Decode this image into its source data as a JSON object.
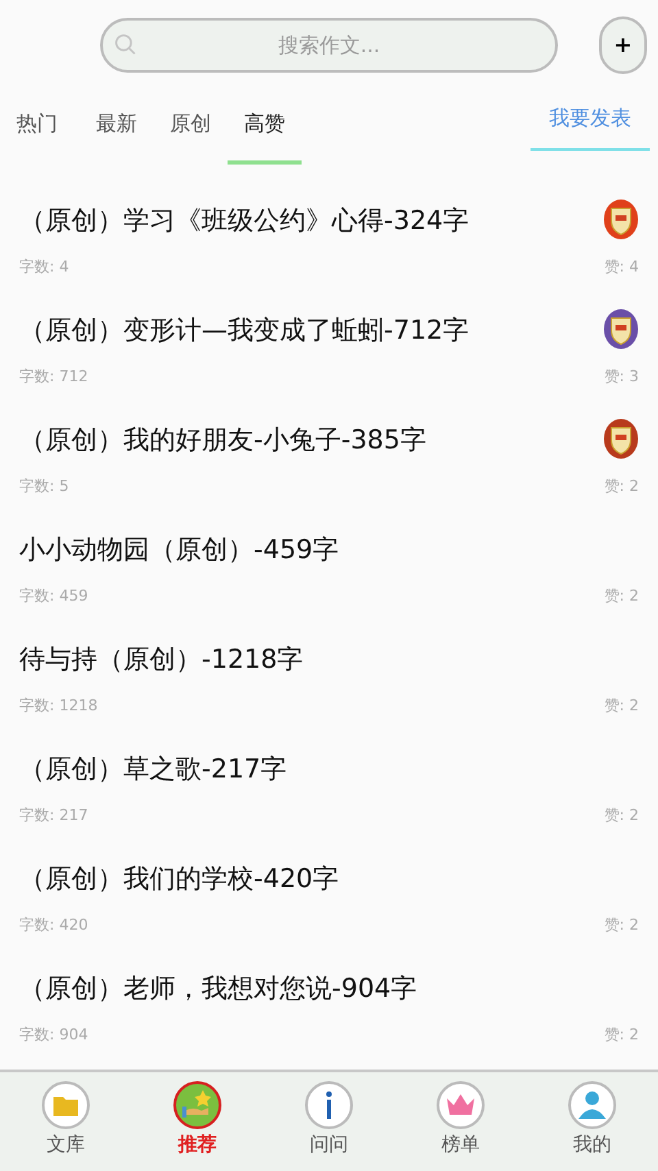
{
  "search": {
    "placeholder": "搜索作文..."
  },
  "add_button": {
    "label": "+"
  },
  "tabs": [
    {
      "label": "热门",
      "selected": false
    },
    {
      "label": "最新",
      "selected": false
    },
    {
      "label": "原创",
      "selected": false
    },
    {
      "label": "高赞",
      "selected": true
    }
  ],
  "publish_tab": {
    "label": "我要发表"
  },
  "articles": [
    {
      "title": "（原创）学习《班级公约》心得-324字",
      "words": "字数: 4",
      "likes": "赞: 4",
      "color": "#e0401a"
    },
    {
      "title": "（原创）变形计—我变成了蚯蚓-712字",
      "words": "字数: 712",
      "likes": "赞: 3",
      "color": "#6a4fa8"
    },
    {
      "title": "（原创）我的好朋友-小兔子-385字",
      "words": "字数: 5",
      "likes": "赞: 2",
      "color": "#b83a1c"
    },
    {
      "title": "小小动物园（原创）-459字",
      "words": "字数: 459",
      "likes": "赞: 2"
    },
    {
      "title": "待与持（原创）-1218字",
      "words": "字数: 1218",
      "likes": "赞: 2"
    },
    {
      "title": "（原创）草之歌-217字",
      "words": "字数: 217",
      "likes": "赞: 2"
    },
    {
      "title": "（原创）我们的学校-420字",
      "words": "字数: 420",
      "likes": "赞: 2"
    },
    {
      "title": "（原创）老师，我想对您说-904字",
      "words": "字数: 904",
      "likes": "赞: 2"
    }
  ],
  "bottom_nav": [
    {
      "label": "文库",
      "selected": false
    },
    {
      "label": "推荐",
      "selected": true
    },
    {
      "label": "问问",
      "selected": false
    },
    {
      "label": "榜单",
      "selected": false
    },
    {
      "label": "我的",
      "selected": false
    }
  ]
}
